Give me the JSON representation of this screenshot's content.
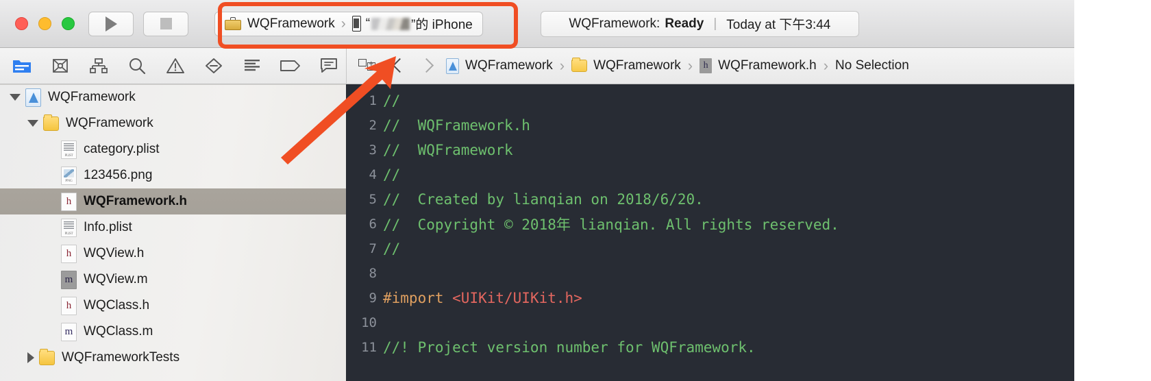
{
  "window": {
    "traffic_lights": [
      "close",
      "minimize",
      "zoom"
    ]
  },
  "toolbar": {
    "run_label": "Run",
    "stop_label": "Stop",
    "scheme": {
      "project": "WQFramework",
      "separator": "›",
      "device_prefix": "“",
      "device_blurred": "",
      "device_suffix": "”的 iPhone",
      "briefcase_icon": "briefcase-icon",
      "phone_icon": "iphone-icon"
    },
    "status": {
      "scheme": "WQFramework:",
      "state": "Ready",
      "divider": "|",
      "time": "Today at 下午3:44"
    }
  },
  "navigator_toolbar": {
    "items": [
      {
        "name": "project-navigator-icon",
        "label": "Project navigator",
        "active": true
      },
      {
        "name": "source-control-navigator-icon",
        "label": "Source control navigator",
        "active": false
      },
      {
        "name": "symbol-navigator-icon",
        "label": "Symbol navigator",
        "active": false
      },
      {
        "name": "find-navigator-icon",
        "label": "Find navigator",
        "active": false
      },
      {
        "name": "issue-navigator-icon",
        "label": "Issue navigator",
        "active": false
      },
      {
        "name": "test-navigator-icon",
        "label": "Test navigator",
        "active": false
      },
      {
        "name": "debug-navigator-icon",
        "label": "Debug navigator",
        "active": false
      },
      {
        "name": "breakpoint-navigator-icon",
        "label": "Breakpoint navigator",
        "active": false
      },
      {
        "name": "report-navigator-icon",
        "label": "Report navigator",
        "active": false
      }
    ]
  },
  "jumpbar": {
    "assistant_icon": "assistant-editor-icon",
    "back_label": "Back",
    "forward_label": "Forward",
    "separator": "›",
    "crumbs": [
      {
        "icon": "project-icon",
        "label": "WQFramework"
      },
      {
        "icon": "folder-icon",
        "label": "WQFramework"
      },
      {
        "icon": "header-file-icon",
        "label": "WQFramework.h"
      },
      {
        "icon": "",
        "label": "No Selection"
      }
    ]
  },
  "navigator": {
    "rows": [
      {
        "indent": 0,
        "disclosure": "open",
        "icon": "project",
        "label": "WQFramework",
        "selected": false
      },
      {
        "indent": 1,
        "disclosure": "open",
        "icon": "folder",
        "label": "WQFramework",
        "selected": false
      },
      {
        "indent": 2,
        "disclosure": "none",
        "icon": "plist",
        "label": "category.plist",
        "selected": false
      },
      {
        "indent": 2,
        "disclosure": "none",
        "icon": "png",
        "label": "123456.png",
        "selected": false
      },
      {
        "indent": 2,
        "disclosure": "none",
        "icon": "h",
        "label": "WQFramework.h",
        "selected": true
      },
      {
        "indent": 2,
        "disclosure": "none",
        "icon": "plist",
        "label": "Info.plist",
        "selected": false
      },
      {
        "indent": 2,
        "disclosure": "none",
        "icon": "h",
        "label": "WQView.h",
        "selected": false
      },
      {
        "indent": 2,
        "disclosure": "none",
        "icon": "m-grey",
        "label": "WQView.m",
        "selected": false
      },
      {
        "indent": 2,
        "disclosure": "none",
        "icon": "h",
        "label": "WQClass.h",
        "selected": false
      },
      {
        "indent": 2,
        "disclosure": "none",
        "icon": "m",
        "label": "WQClass.m",
        "selected": false
      },
      {
        "indent": 1,
        "disclosure": "closed",
        "icon": "folder",
        "label": "WQFrameworkTests",
        "selected": false
      }
    ]
  },
  "editor": {
    "language": "objective-c",
    "background": "#282c34",
    "colors": {
      "comment": "#6ec06e",
      "preprocessor": "#e0a060",
      "string": "#e4675f",
      "line_number": "#8d929b"
    },
    "lines": [
      {
        "n": "1",
        "segments": [
          {
            "t": "//",
            "c": "c-com"
          }
        ]
      },
      {
        "n": "2",
        "segments": [
          {
            "t": "//  WQFramework.h",
            "c": "c-com"
          }
        ]
      },
      {
        "n": "3",
        "segments": [
          {
            "t": "//  WQFramework",
            "c": "c-com"
          }
        ]
      },
      {
        "n": "4",
        "segments": [
          {
            "t": "//",
            "c": "c-com"
          }
        ]
      },
      {
        "n": "5",
        "segments": [
          {
            "t": "//  Created by lianqian on 2018/6/20.",
            "c": "c-com"
          }
        ]
      },
      {
        "n": "6",
        "segments": [
          {
            "t": "//  Copyright © 2018年 lianqian. All rights reserved.",
            "c": "c-com"
          }
        ]
      },
      {
        "n": "7",
        "segments": [
          {
            "t": "//",
            "c": "c-com"
          }
        ]
      },
      {
        "n": "8",
        "segments": []
      },
      {
        "n": "9",
        "segments": [
          {
            "t": "#import ",
            "c": "c-pre"
          },
          {
            "t": "<UIKit/UIKit.h>",
            "c": "c-str"
          }
        ]
      },
      {
        "n": "10",
        "segments": []
      },
      {
        "n": "11",
        "segments": [
          {
            "t": "//! Project version number for WQFramework.",
            "c": "c-com"
          }
        ]
      }
    ]
  },
  "annotations": {
    "highlight_color": "#f04e23",
    "box_target": "scheme-selector",
    "arrow_target": "assistant-editor-icon"
  }
}
